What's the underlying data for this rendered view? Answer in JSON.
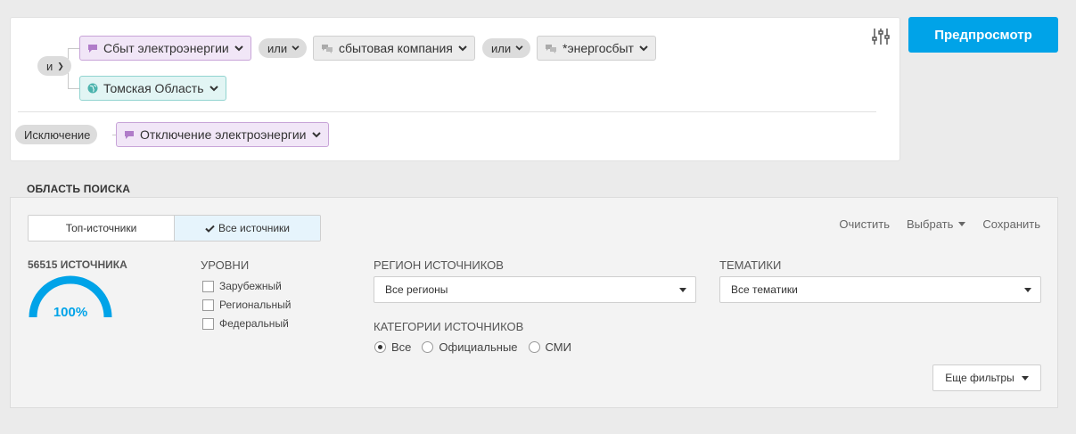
{
  "query": {
    "operator_and": "и",
    "operator_or_1": "или",
    "operator_or_2": "или",
    "tags": {
      "t1": "Сбыт электроэнергии",
      "t2": "сбытовая компания",
      "t3": "*энергосбыт",
      "region": "Томская Область"
    },
    "exclusion_label": "Исключение",
    "exclusion_tag": "Отключение электроэнергии"
  },
  "header": {
    "preview_label": "Предпросмотр"
  },
  "search_area": {
    "title": "ОБЛАСТЬ ПОИСКА",
    "tabs": [
      {
        "label": "Топ-источники"
      },
      {
        "label": "Все источники",
        "checked_icon": "check-icon"
      }
    ],
    "actions": {
      "clear": "Очистить",
      "select": "Выбрать",
      "save": "Сохранить"
    },
    "count_label": "56515 ИСТОЧНИКА",
    "gauge_value": "100%",
    "gauge_fraction": 1.0,
    "levels": {
      "title": "УРОВНИ",
      "items": [
        {
          "label": "Зарубежный",
          "checked": false
        },
        {
          "label": "Региональный",
          "checked": false
        },
        {
          "label": "Федеральный",
          "checked": false
        }
      ]
    },
    "region": {
      "title": "РЕГИОН ИСТОЧНИКОВ",
      "value": "Все регионы"
    },
    "topics": {
      "title": "ТЕМАТИКИ",
      "value": "Все тематики"
    },
    "categories": {
      "title": "КАТЕГОРИИ ИСТОЧНИКОВ",
      "options": [
        {
          "label": "Все",
          "selected": true
        },
        {
          "label": "Официальные",
          "selected": false
        },
        {
          "label": "СМИ",
          "selected": false
        }
      ]
    },
    "more_filters": "Еще фильтры"
  },
  "colors": {
    "accent": "#00a3e8",
    "purple_tag_bg": "#f1e6f7",
    "teal_tag_bg": "#e2f5f4"
  }
}
